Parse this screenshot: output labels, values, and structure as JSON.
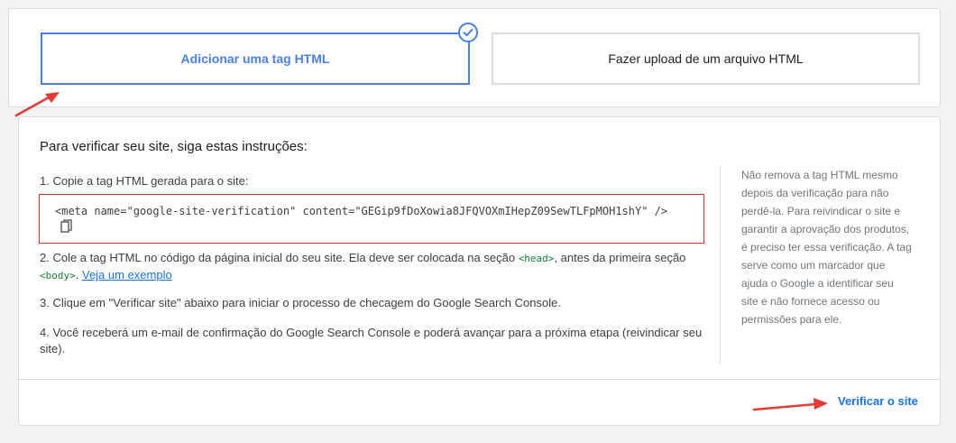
{
  "methods": {
    "html_tag_label": "Adicionar uma tag HTML",
    "upload_label": "Fazer upload de um arquivo HTML"
  },
  "instructions": {
    "title": "Para verificar seu site, siga estas instruções:",
    "step1": "1. Copie a tag HTML gerada para o site:",
    "code": "<meta name=\"google-site-verification\" content=\"GEGip9fDoXowia8JFQVOXmIHepZ09SewTLFpMOH1shY\" />",
    "step2_text_a": "2. Cole a tag HTML no código da página inicial do seu site. Ela deve ser colocada na seção ",
    "step2_code_head": "<head>",
    "step2_text_b": ", antes da primeira seção ",
    "step2_code_body": "<body>",
    "step2_text_c": ". ",
    "step2_link": "Veja um exemplo",
    "step3": "3. Clique em \"Verificar site\" abaixo para iniciar o processo de checagem do Google Search Console.",
    "step4": "4. Você receberá um e-mail de confirmação do Google Search Console e poderá avançar para a próxima etapa (reivindicar seu site).",
    "side_note": "Não remova a tag HTML mesmo depois da verificação para não perdê-la. Para reivindicar o site e garantir a aprovação dos produtos, é preciso ter essa verificação. A tag serve como um marcador que ajuda o Google a identificar seu site e não fornece acesso ou permissões para ele.",
    "verify_button": "Verificar o site"
  },
  "colors": {
    "accent": "#4a7fe5",
    "link": "#1a73e8",
    "annotation_red": "#e53935",
    "code_border": "#d93025"
  },
  "icons": [
    "check-circle-icon",
    "copy-icon",
    "annotation-arrow-icon"
  ]
}
